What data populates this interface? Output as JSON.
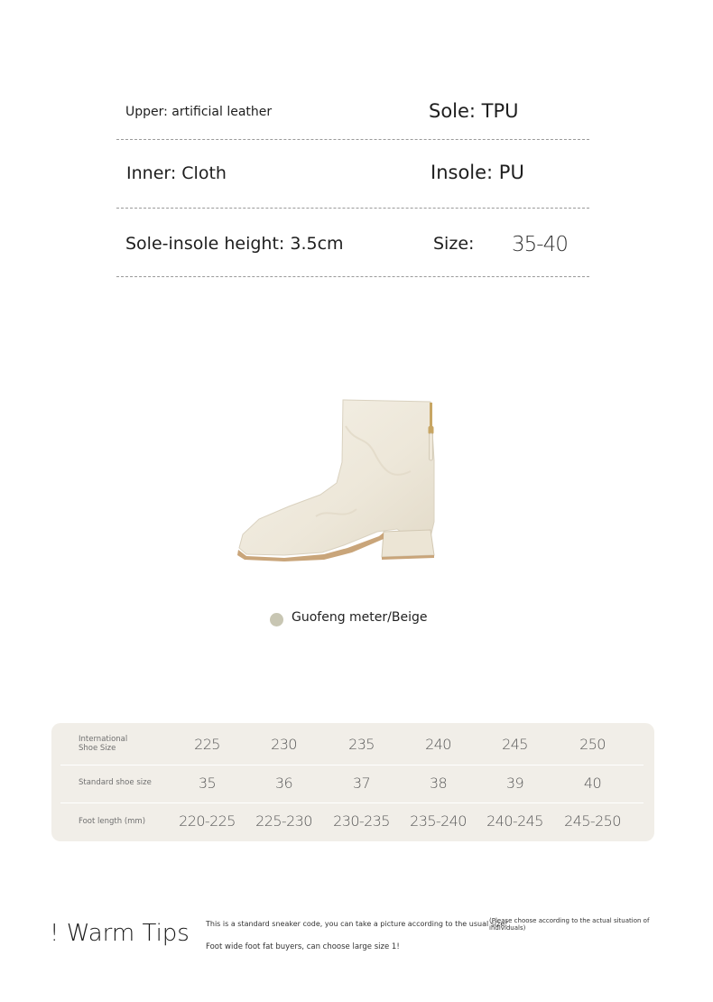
{
  "specs": {
    "upper": "Upper: artificial leather",
    "sole": "Sole: TPU",
    "inner": "Inner: Cloth",
    "insole": "Insole: PU",
    "height": "Sole-insole height: 3.5cm",
    "size_label": "Size:",
    "size_value": "35-40"
  },
  "colors": {
    "swatch": "#c8c6b3",
    "table_bg": "#f1eee8",
    "shoe_body": "#f0ebdf",
    "sole_trim": "#c9a57a"
  },
  "product": {
    "color_name": "Guofeng meter/Beige",
    "image_icon": "beige-ankle-boot-icon"
  },
  "size_table": {
    "rows": [
      {
        "label": "International Shoe Size",
        "values": [
          "225",
          "230",
          "235",
          "240",
          "245",
          "250"
        ]
      },
      {
        "label": "Standard shoe size",
        "values": [
          "35",
          "36",
          "37",
          "38",
          "39",
          "40"
        ]
      },
      {
        "label": "Foot length (mm)",
        "values": [
          "220-225",
          "225-230",
          "230-235",
          "235-240",
          "240-245",
          "245-250"
        ]
      }
    ]
  },
  "tips": {
    "title": "! Warm Tips",
    "line1": "This is a standard sneaker code, you can take a picture according to the usual size!",
    "line1_note": "(Please choose according to the actual situation of individuals)",
    "line2": "Foot wide foot fat buyers, can choose large size 1!"
  }
}
